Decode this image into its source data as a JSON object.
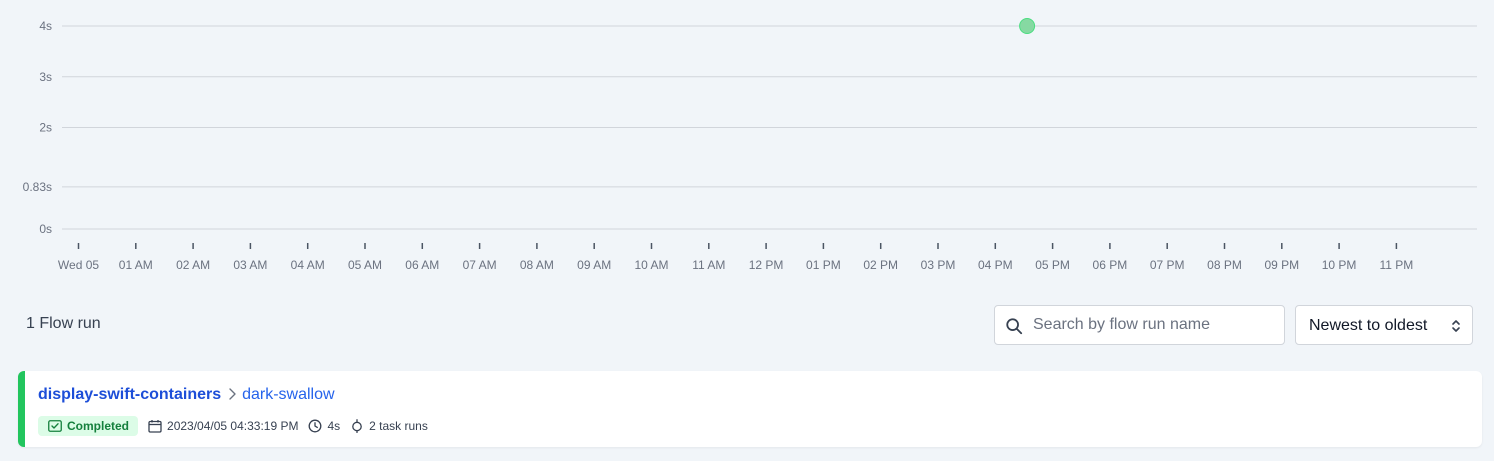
{
  "chart_data": {
    "type": "scatter",
    "title": "",
    "xlabel": "",
    "ylabel": "",
    "x_tick_labels": [
      "Wed 05",
      "01 AM",
      "02 AM",
      "03 AM",
      "04 AM",
      "05 AM",
      "06 AM",
      "07 AM",
      "08 AM",
      "09 AM",
      "10 AM",
      "11 AM",
      "12 PM",
      "01 PM",
      "02 PM",
      "03 PM",
      "04 PM",
      "05 PM",
      "06 PM",
      "07 PM",
      "08 PM",
      "09 PM",
      "10 PM",
      "11 PM"
    ],
    "y_ticks": [
      {
        "value": 0,
        "label": "0s"
      },
      {
        "value": 0.83,
        "label": "0.83s"
      },
      {
        "value": 2,
        "label": "2s"
      },
      {
        "value": 3,
        "label": "3s"
      },
      {
        "value": 4,
        "label": "4s"
      }
    ],
    "ylim": [
      0,
      4
    ],
    "grid": true,
    "points": [
      {
        "x": "2023-04-05 16:33:19",
        "x_hours": 16.555,
        "y": 4,
        "state": "Completed"
      }
    ],
    "colors": {
      "point": "#86d9a2",
      "point_stroke": "#4ade80",
      "grid": "#d1d5db"
    }
  },
  "runs_summary": {
    "count_label": "1 Flow run"
  },
  "search": {
    "placeholder": "Search by flow run name",
    "icon": "search-icon"
  },
  "sort": {
    "selected": "Newest to oldest",
    "icon": "chevron-up-down-icon"
  },
  "flow_runs": [
    {
      "flow_name": "display-swift-containers",
      "run_name": "dark-swallow",
      "state": "Completed",
      "start_time": "2023/04/05 04:33:19 PM",
      "duration": "4s",
      "task_runs": "2 task runs"
    }
  ],
  "colors": {
    "completed": "#22c55e",
    "link": "#1d4ed8",
    "background": "#f1f5f9"
  }
}
